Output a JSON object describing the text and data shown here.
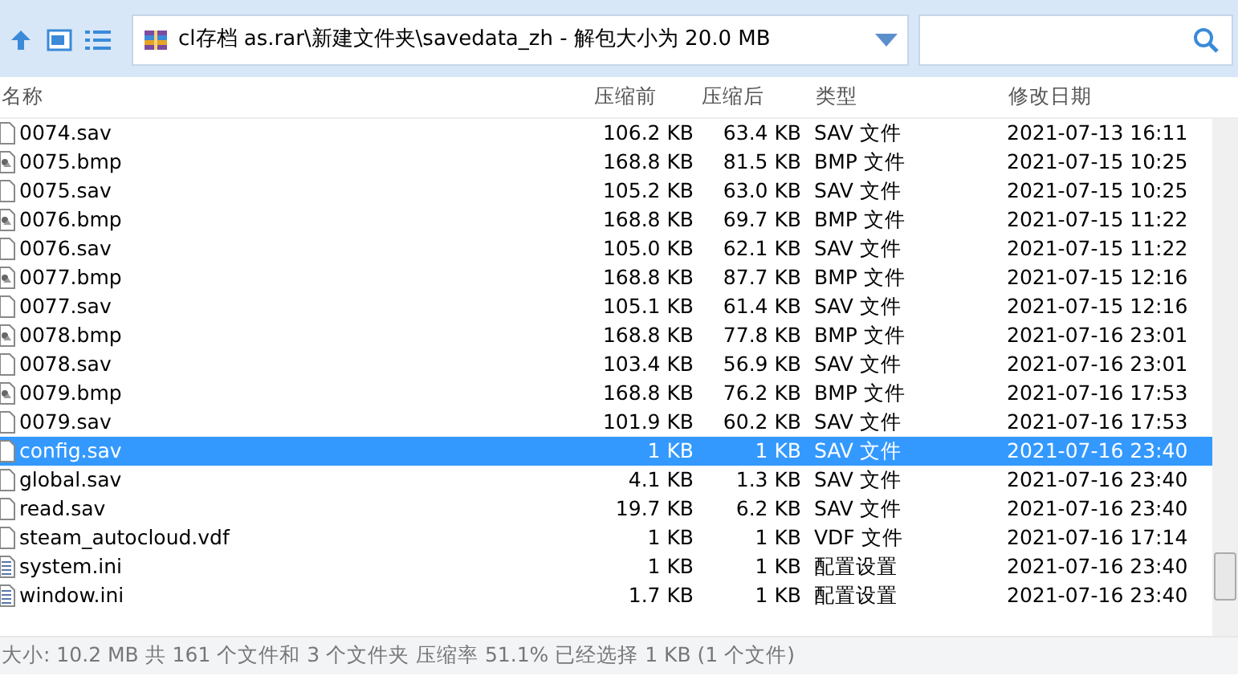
{
  "address": {
    "text": "cl存档 as.rar\\新建文件夹\\savedata_zh - 解包大小为 20.0 MB"
  },
  "columns": [
    "名称",
    "压缩前",
    "压缩后",
    "类型",
    "修改日期"
  ],
  "rows": [
    {
      "kind": "document",
      "name": "0074.sav",
      "size": "106.2 KB",
      "packed": "63.4 KB",
      "type": "SAV 文件",
      "modified": "2021-07-13 16:11",
      "selected": false
    },
    {
      "kind": "image",
      "name": "0075.bmp",
      "size": "168.8 KB",
      "packed": "81.5 KB",
      "type": "BMP 文件",
      "modified": "2021-07-15 10:25",
      "selected": false
    },
    {
      "kind": "document",
      "name": "0075.sav",
      "size": "105.2 KB",
      "packed": "63.0 KB",
      "type": "SAV 文件",
      "modified": "2021-07-15 10:25",
      "selected": false
    },
    {
      "kind": "image",
      "name": "0076.bmp",
      "size": "168.8 KB",
      "packed": "69.7 KB",
      "type": "BMP 文件",
      "modified": "2021-07-15 11:22",
      "selected": false
    },
    {
      "kind": "document",
      "name": "0076.sav",
      "size": "105.0 KB",
      "packed": "62.1 KB",
      "type": "SAV 文件",
      "modified": "2021-07-15 11:22",
      "selected": false
    },
    {
      "kind": "image",
      "name": "0077.bmp",
      "size": "168.8 KB",
      "packed": "87.7 KB",
      "type": "BMP 文件",
      "modified": "2021-07-15 12:16",
      "selected": false
    },
    {
      "kind": "document",
      "name": "0077.sav",
      "size": "105.1 KB",
      "packed": "61.4 KB",
      "type": "SAV 文件",
      "modified": "2021-07-15 12:16",
      "selected": false
    },
    {
      "kind": "image",
      "name": "0078.bmp",
      "size": "168.8 KB",
      "packed": "77.8 KB",
      "type": "BMP 文件",
      "modified": "2021-07-16 23:01",
      "selected": false
    },
    {
      "kind": "document",
      "name": "0078.sav",
      "size": "103.4 KB",
      "packed": "56.9 KB",
      "type": "SAV 文件",
      "modified": "2021-07-16 23:01",
      "selected": false
    },
    {
      "kind": "image",
      "name": "0079.bmp",
      "size": "168.8 KB",
      "packed": "76.2 KB",
      "type": "BMP 文件",
      "modified": "2021-07-16 17:53",
      "selected": false
    },
    {
      "kind": "document",
      "name": "0079.sav",
      "size": "101.9 KB",
      "packed": "60.2 KB",
      "type": "SAV 文件",
      "modified": "2021-07-16 17:53",
      "selected": false
    },
    {
      "kind": "document",
      "name": "config.sav",
      "size": "1 KB",
      "packed": "1 KB",
      "type": "SAV 文件",
      "modified": "2021-07-16 23:40",
      "selected": true
    },
    {
      "kind": "document",
      "name": "global.sav",
      "size": "4.1 KB",
      "packed": "1.3 KB",
      "type": "SAV 文件",
      "modified": "2021-07-16 23:40",
      "selected": false
    },
    {
      "kind": "document",
      "name": "read.sav",
      "size": "19.7 KB",
      "packed": "6.2 KB",
      "type": "SAV 文件",
      "modified": "2021-07-16 23:40",
      "selected": false
    },
    {
      "kind": "document",
      "name": "steam_autocloud.vdf",
      "size": "1 KB",
      "packed": "1 KB",
      "type": "VDF 文件",
      "modified": "2021-07-16 17:14",
      "selected": false
    },
    {
      "kind": "settings",
      "name": "system.ini",
      "size": "1 KB",
      "packed": "1 KB",
      "type": "配置设置",
      "modified": "2021-07-16 23:40",
      "selected": false
    },
    {
      "kind": "settings",
      "name": "window.ini",
      "size": "1.7 KB",
      "packed": "1 KB",
      "type": "配置设置",
      "modified": "2021-07-16 23:40",
      "selected": false
    }
  ],
  "status_bar": "大小: 10.2 MB 共 161 个文件和 3 个文件夹 压缩率 51.1% 已经选择 1 KB (1 个文件)"
}
